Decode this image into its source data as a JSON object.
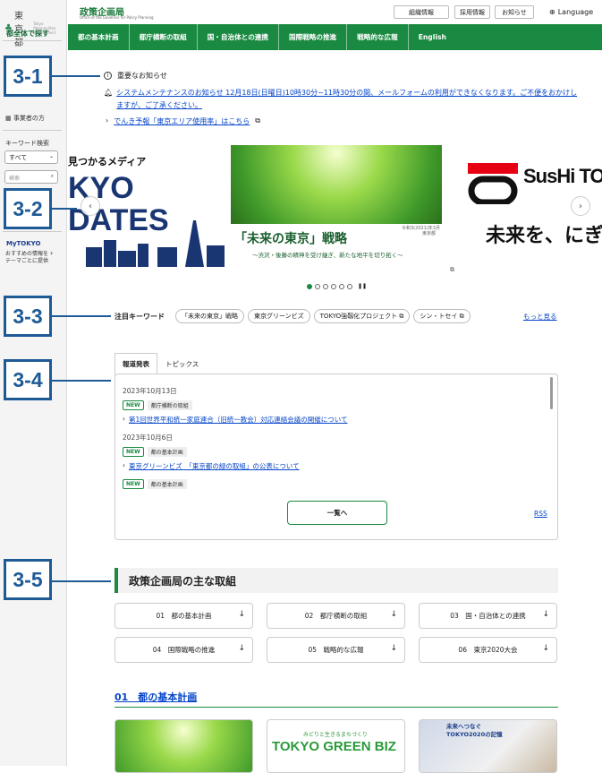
{
  "sidebar": {
    "logo_text": "東京都",
    "logo_sub": "Tokyo Metropolitan Government",
    "search_all": "都全体で探す",
    "business_label": "事業者の方",
    "keyword_label": "キーワード検索",
    "select_value": "すべて",
    "search_placeholder": "検索",
    "mytokyo_title": "MyTOKYO",
    "mytokyo_desc": "おすすめの情報をテーマごとに提供"
  },
  "header": {
    "title": "政策企画局",
    "subtitle": "Office of the Governor for Policy Planning",
    "utils": [
      "組織情報",
      "採用情報",
      "お知らせ"
    ],
    "language": "Language"
  },
  "nav": [
    "都の基本計画",
    "都庁横断の取組",
    "国・自治体との連携",
    "国際戦略の推進",
    "戦略的な広報",
    "English"
  ],
  "callouts": [
    "3-1",
    "3-2",
    "3-3",
    "3-4",
    "3-5"
  ],
  "notices": {
    "heading": "重要なお知らせ",
    "item1": "システムメンテナンスのお知らせ 12月18日(日曜日)10時30分~11時30分の間、メールフォームの利用ができなくなります。ご不便をおかけしますが、ご了承ください。",
    "item2": "でんき予報「東京エリア使用率」はこちら"
  },
  "carousel": {
    "left_title": "見つかるメディア",
    "left_big": "KYO\nDATES",
    "center_title": "「未来の東京」戦略",
    "center_sub": "～渋沢・後藤の精神を受け継ぎ、新たな地平を切り拓く～",
    "center_mark": "令和3(2021)年3月\n東京都",
    "right_title": "SusHi TOKYO",
    "right_tag": "未来を、にぎ",
    "slides_total": 6,
    "active_slide": 1
  },
  "keywords": {
    "label": "注目キーワード",
    "items": [
      "「未来の東京」戦略",
      "東京グリーンビズ",
      "TOKYO強靱化プロジェクト",
      "シン・トセイ"
    ],
    "more": "もっと見る"
  },
  "press": {
    "tabs": [
      "報道発表",
      "トピックス"
    ],
    "items": [
      {
        "date": "2023年10月13日",
        "category": "都庁横断の取組",
        "title": "第1回世界平和統一家庭連合（旧統一教会）対応連絡会議の開催について"
      },
      {
        "date": "2023年10月6日",
        "category": "都の基本計画",
        "title": "東京グリーンビズ　「東京都の緑の取組」の公表について"
      },
      {
        "date": "",
        "category": "都の基本計画",
        "title": ""
      }
    ],
    "new_label": "NEW",
    "more_button": "一覧へ",
    "rss": "RSS"
  },
  "initiatives": {
    "heading": "政策企画局の主な取組",
    "cards": [
      "01　都の基本計画",
      "02　都庁横断の取組",
      "03　国・自治体との連携",
      "04　国際戦略の推進",
      "05　戦略的な広報",
      "06　東京2020大会"
    ]
  },
  "plan": {
    "heading": "01　都の基本計画",
    "thumb2_title": "TOKYO GREEN BIZ",
    "thumb2_sub": "みどりと生きるまちづくり",
    "thumb3_title": "未来へつなぐ\nTOKYO2020の記憶"
  },
  "colors": {
    "brand_green": "#1a8a42",
    "callout_blue": "#1e5a96",
    "link_blue": "#0645c8"
  }
}
